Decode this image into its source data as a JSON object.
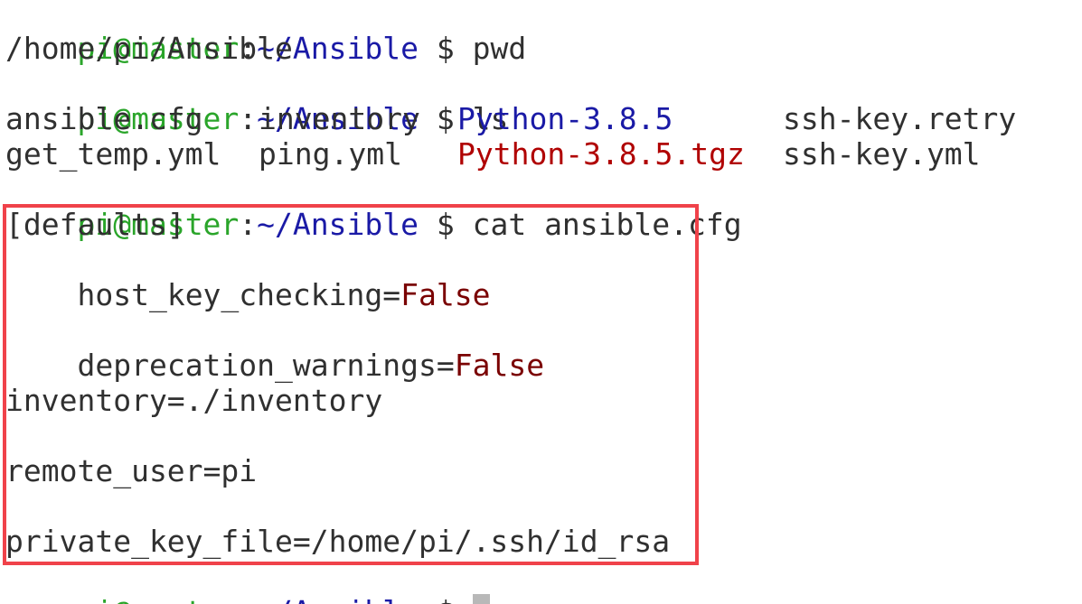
{
  "prompt": {
    "user_host": "pi@master",
    "separator": ":",
    "path": "~/Ansible",
    "symbol": " $ "
  },
  "lines": {
    "cmd_pwd": "pwd",
    "pwd_output": "/home/pi/Ansible",
    "cmd_ls": "ls",
    "cmd_cat": "cat ansible.cfg"
  },
  "ls_output": {
    "row1": [
      "ansible.cfg",
      "inventory",
      "Python-3.8.5",
      "ssh-key.retry"
    ],
    "row2": [
      "get_temp.yml",
      "ping.yml",
      "Python-3.8.5.tgz",
      "ssh-key.yml"
    ]
  },
  "config": {
    "section": "[defaults]",
    "host_key_checking_key": "host_key_checking=",
    "host_key_checking_value": "False",
    "deprecation_warnings_key": "deprecation_warnings=",
    "deprecation_warnings_value": "False",
    "inventory_line": "inventory=./inventory",
    "remote_user_line": "remote_user=pi",
    "private_key_file_line": "private_key_file=/home/pi/.ssh/id_rsa"
  },
  "colors": {
    "prompt_user": "#2aa52a",
    "prompt_path": "#1a1aa6",
    "directory": "#1a1aa6",
    "archive": "#b00000",
    "value_false": "#7a0000",
    "highlight_border": "#f0424a"
  }
}
